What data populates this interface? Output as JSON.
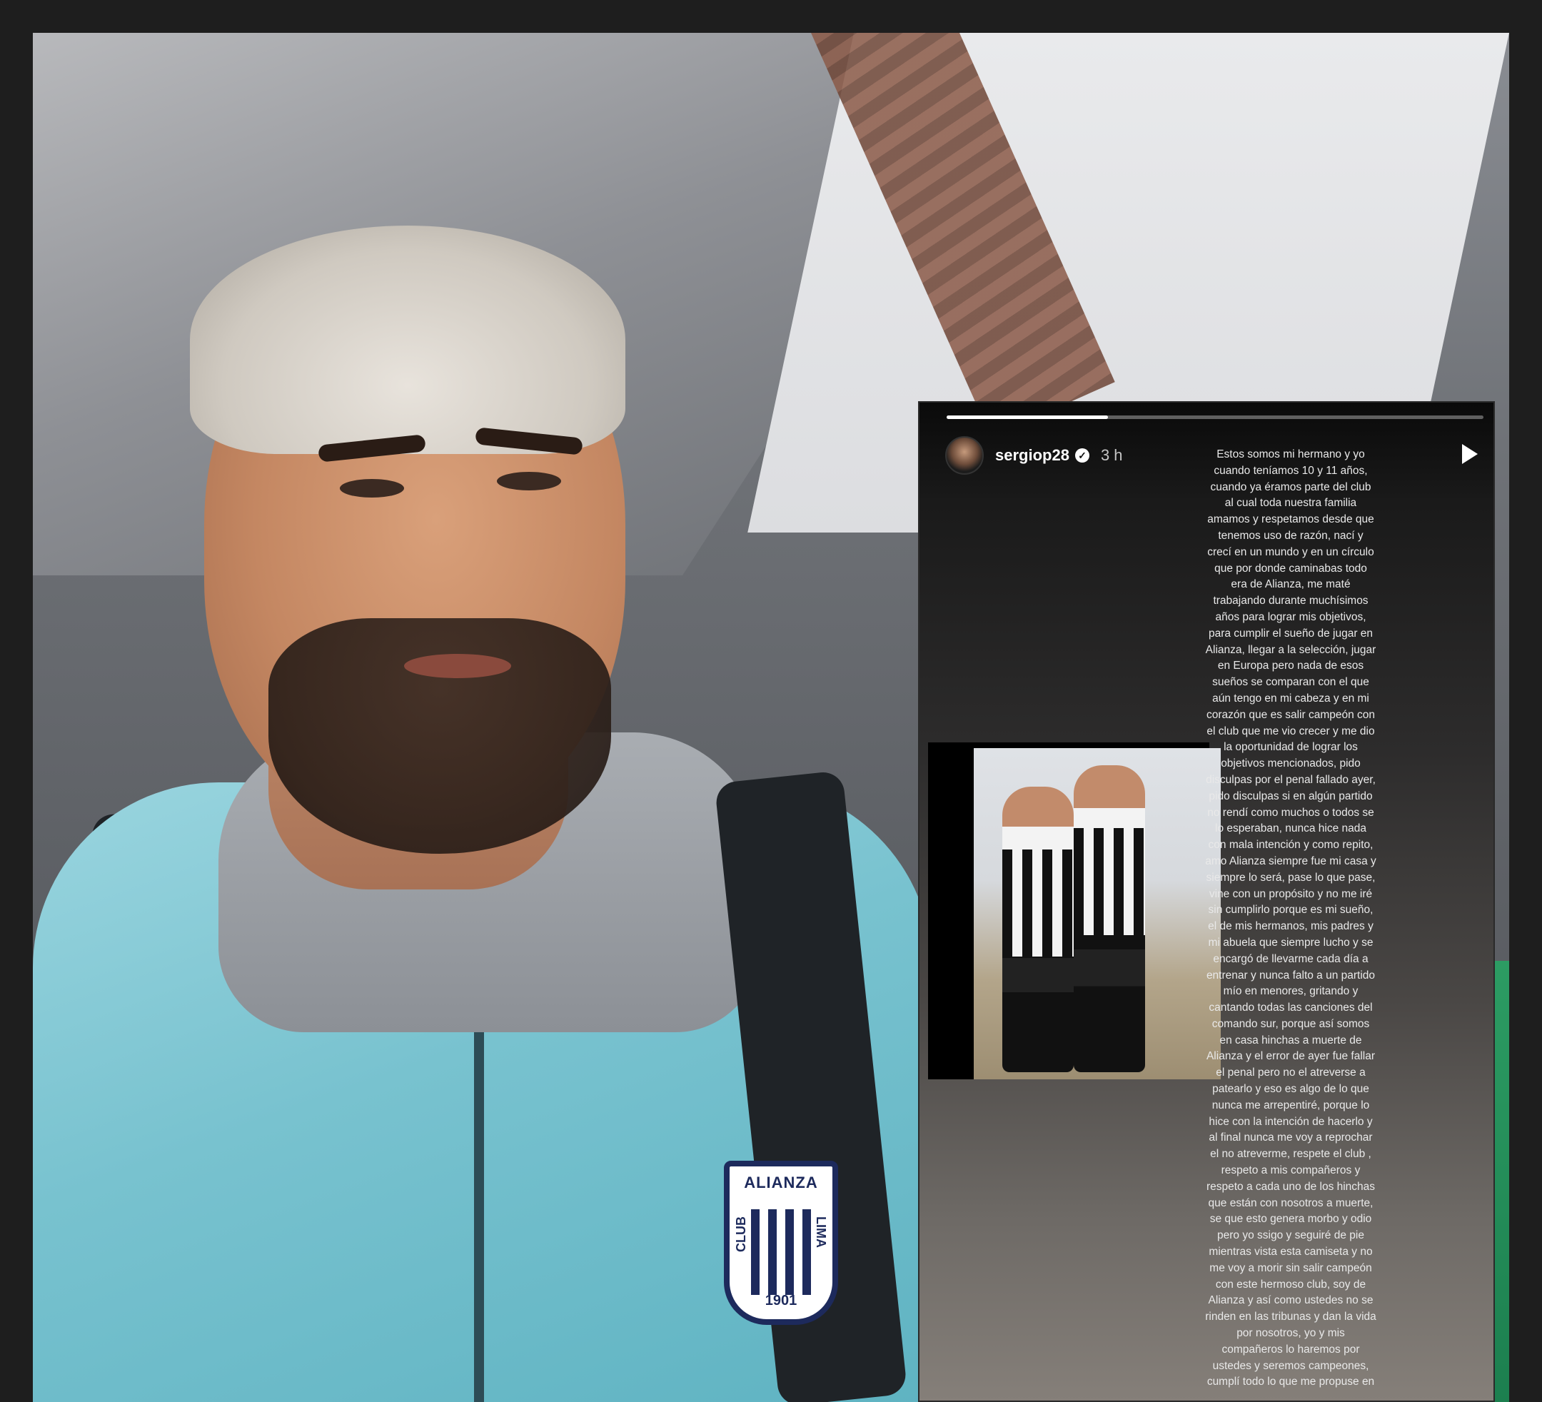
{
  "story": {
    "username": "sergiop28",
    "time": "3 h",
    "progress": 0.3,
    "text": "Estos somos mi hermano y yo cuando teníamos 10 y 11 años, cuando ya éramos parte del club al cual toda nuestra familia amamos y respetamos desde que tenemos uso de razón, nací y crecí en un mundo y en un círculo que por donde caminabas todo era de Alianza, me maté trabajando durante muchísimos años para lograr mis objetivos, para cumplir el sueño de jugar en Alianza, llegar a la selección, jugar en Europa pero nada de esos sueños se comparan con el que aún tengo en mi cabeza y en mi corazón que es salir campeón con el club que me vio crecer y me dio la oportunidad de lograr los objetivos mencionados, pido disculpas por el penal fallado ayer, pido disculpas si en algún partido no rendí como muchos o todos se lo esperaban, nunca hice nada con mala intención y como repito, amo Alianza siempre fue mi casa y siempre lo será, pase lo que pase, vine con un propósito y no me iré sin cumplirlo porque es mi sueño, el de mis hermanos, mis padres y mi abuela que siempre lucho y se encargó de llevarme cada día a entrenar y nunca falto a un partido mío en menores, gritando y cantando todas las canciones del comando sur, porque así somos en casa hinchas a muerte de Alianza y el error de ayer fue fallar el penal pero no el atreverse a patearlo y eso es algo de lo que nunca me arrepentiré, porque lo hice con la intención de hacerlo y al final nunca me voy a reprochar el no atreverme, respete el club , respeto a mis compañeros y respeto a cada uno de los hinchas que están con nosotros a muerte, se que esto genera morbo y odio pero yo ssigo y seguiré de pie mientras vista esta camiseta y no me voy a morir sin salir campeón con este hermoso club, soy de Alianza y así como ustedes no se rinden en las tribunas y dan la vida por nosotros, yo y mis compañeros lo haremos por ustedes y seremos campeones, cumplí todo lo que me propuse en"
  },
  "badge": {
    "top": "ALIANZA",
    "left": "CLUB",
    "right": "LIMA",
    "year": "1901"
  },
  "icons": {
    "verified": "verified-icon",
    "play": "play-icon"
  },
  "colors": {
    "jacket": "#78c2cf",
    "badge_navy": "#1d2a5c",
    "frame": "#1e1e1e"
  }
}
